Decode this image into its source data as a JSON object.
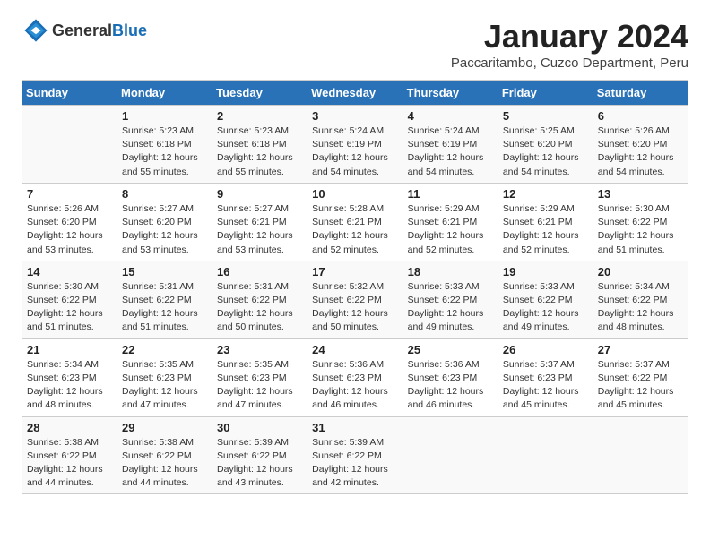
{
  "header": {
    "logo_general": "General",
    "logo_blue": "Blue",
    "month": "January 2024",
    "location": "Paccaritambo, Cuzco Department, Peru"
  },
  "weekdays": [
    "Sunday",
    "Monday",
    "Tuesday",
    "Wednesday",
    "Thursday",
    "Friday",
    "Saturday"
  ],
  "weeks": [
    [
      {
        "day": "",
        "info": ""
      },
      {
        "day": "1",
        "info": "Sunrise: 5:23 AM\nSunset: 6:18 PM\nDaylight: 12 hours\nand 55 minutes."
      },
      {
        "day": "2",
        "info": "Sunrise: 5:23 AM\nSunset: 6:18 PM\nDaylight: 12 hours\nand 55 minutes."
      },
      {
        "day": "3",
        "info": "Sunrise: 5:24 AM\nSunset: 6:19 PM\nDaylight: 12 hours\nand 54 minutes."
      },
      {
        "day": "4",
        "info": "Sunrise: 5:24 AM\nSunset: 6:19 PM\nDaylight: 12 hours\nand 54 minutes."
      },
      {
        "day": "5",
        "info": "Sunrise: 5:25 AM\nSunset: 6:20 PM\nDaylight: 12 hours\nand 54 minutes."
      },
      {
        "day": "6",
        "info": "Sunrise: 5:26 AM\nSunset: 6:20 PM\nDaylight: 12 hours\nand 54 minutes."
      }
    ],
    [
      {
        "day": "7",
        "info": "Sunrise: 5:26 AM\nSunset: 6:20 PM\nDaylight: 12 hours\nand 53 minutes."
      },
      {
        "day": "8",
        "info": "Sunrise: 5:27 AM\nSunset: 6:20 PM\nDaylight: 12 hours\nand 53 minutes."
      },
      {
        "day": "9",
        "info": "Sunrise: 5:27 AM\nSunset: 6:21 PM\nDaylight: 12 hours\nand 53 minutes."
      },
      {
        "day": "10",
        "info": "Sunrise: 5:28 AM\nSunset: 6:21 PM\nDaylight: 12 hours\nand 52 minutes."
      },
      {
        "day": "11",
        "info": "Sunrise: 5:29 AM\nSunset: 6:21 PM\nDaylight: 12 hours\nand 52 minutes."
      },
      {
        "day": "12",
        "info": "Sunrise: 5:29 AM\nSunset: 6:21 PM\nDaylight: 12 hours\nand 52 minutes."
      },
      {
        "day": "13",
        "info": "Sunrise: 5:30 AM\nSunset: 6:22 PM\nDaylight: 12 hours\nand 51 minutes."
      }
    ],
    [
      {
        "day": "14",
        "info": "Sunrise: 5:30 AM\nSunset: 6:22 PM\nDaylight: 12 hours\nand 51 minutes."
      },
      {
        "day": "15",
        "info": "Sunrise: 5:31 AM\nSunset: 6:22 PM\nDaylight: 12 hours\nand 51 minutes."
      },
      {
        "day": "16",
        "info": "Sunrise: 5:31 AM\nSunset: 6:22 PM\nDaylight: 12 hours\nand 50 minutes."
      },
      {
        "day": "17",
        "info": "Sunrise: 5:32 AM\nSunset: 6:22 PM\nDaylight: 12 hours\nand 50 minutes."
      },
      {
        "day": "18",
        "info": "Sunrise: 5:33 AM\nSunset: 6:22 PM\nDaylight: 12 hours\nand 49 minutes."
      },
      {
        "day": "19",
        "info": "Sunrise: 5:33 AM\nSunset: 6:22 PM\nDaylight: 12 hours\nand 49 minutes."
      },
      {
        "day": "20",
        "info": "Sunrise: 5:34 AM\nSunset: 6:22 PM\nDaylight: 12 hours\nand 48 minutes."
      }
    ],
    [
      {
        "day": "21",
        "info": "Sunrise: 5:34 AM\nSunset: 6:23 PM\nDaylight: 12 hours\nand 48 minutes."
      },
      {
        "day": "22",
        "info": "Sunrise: 5:35 AM\nSunset: 6:23 PM\nDaylight: 12 hours\nand 47 minutes."
      },
      {
        "day": "23",
        "info": "Sunrise: 5:35 AM\nSunset: 6:23 PM\nDaylight: 12 hours\nand 47 minutes."
      },
      {
        "day": "24",
        "info": "Sunrise: 5:36 AM\nSunset: 6:23 PM\nDaylight: 12 hours\nand 46 minutes."
      },
      {
        "day": "25",
        "info": "Sunrise: 5:36 AM\nSunset: 6:23 PM\nDaylight: 12 hours\nand 46 minutes."
      },
      {
        "day": "26",
        "info": "Sunrise: 5:37 AM\nSunset: 6:23 PM\nDaylight: 12 hours\nand 45 minutes."
      },
      {
        "day": "27",
        "info": "Sunrise: 5:37 AM\nSunset: 6:22 PM\nDaylight: 12 hours\nand 45 minutes."
      }
    ],
    [
      {
        "day": "28",
        "info": "Sunrise: 5:38 AM\nSunset: 6:22 PM\nDaylight: 12 hours\nand 44 minutes."
      },
      {
        "day": "29",
        "info": "Sunrise: 5:38 AM\nSunset: 6:22 PM\nDaylight: 12 hours\nand 44 minutes."
      },
      {
        "day": "30",
        "info": "Sunrise: 5:39 AM\nSunset: 6:22 PM\nDaylight: 12 hours\nand 43 minutes."
      },
      {
        "day": "31",
        "info": "Sunrise: 5:39 AM\nSunset: 6:22 PM\nDaylight: 12 hours\nand 42 minutes."
      },
      {
        "day": "",
        "info": ""
      },
      {
        "day": "",
        "info": ""
      },
      {
        "day": "",
        "info": ""
      }
    ]
  ]
}
